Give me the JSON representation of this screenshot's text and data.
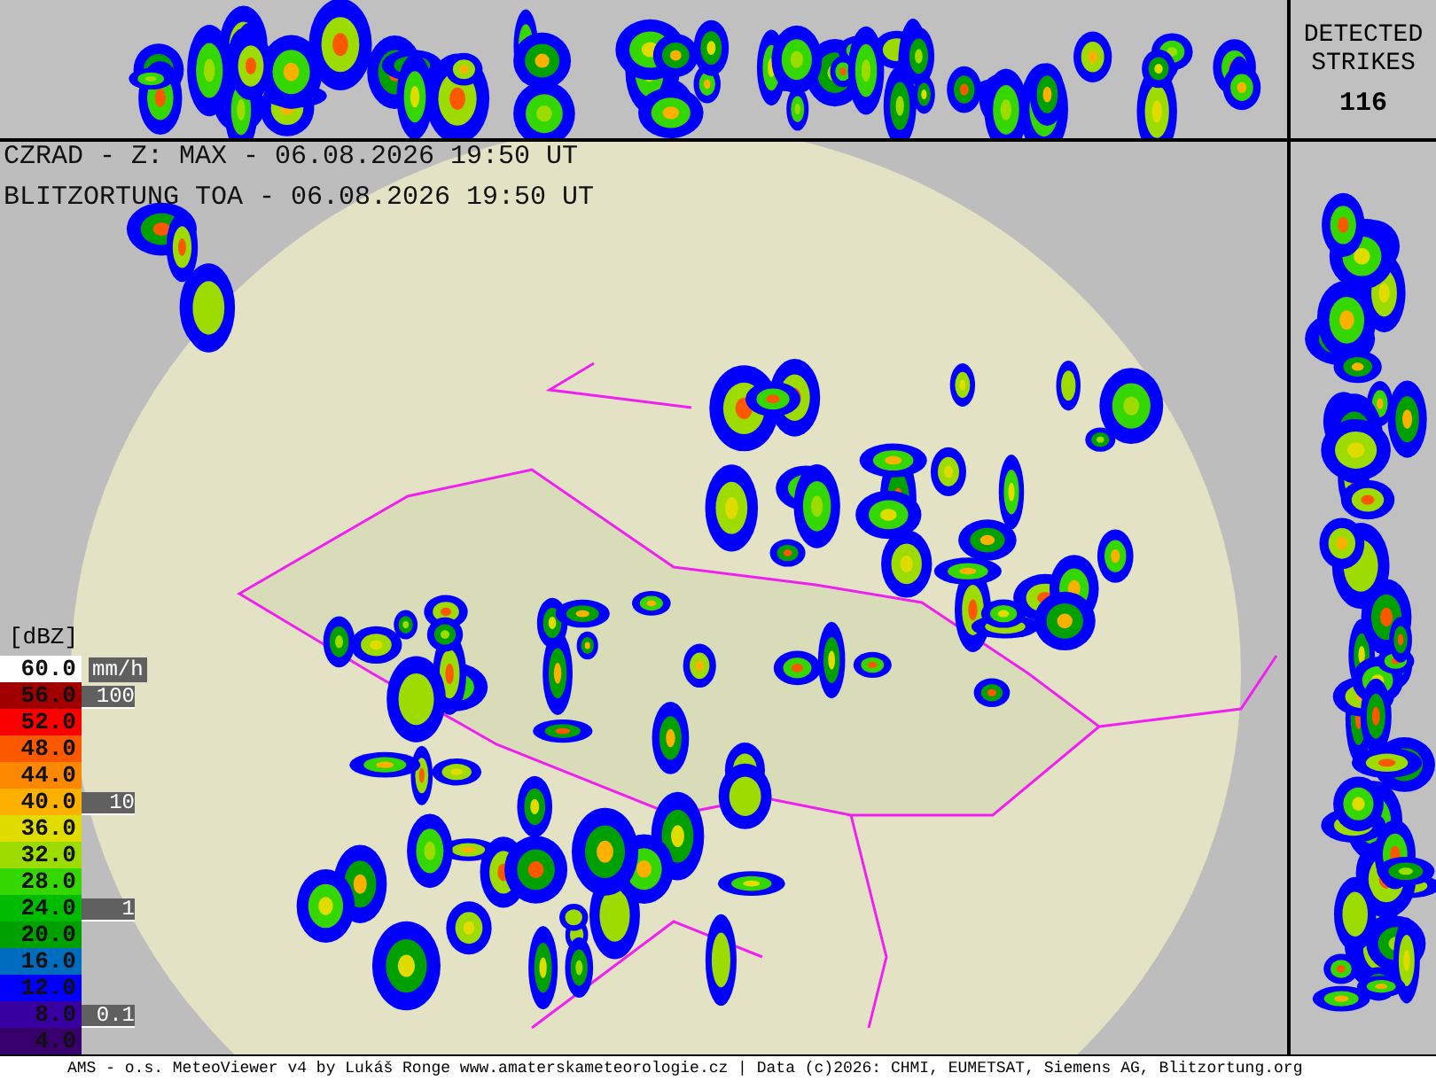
{
  "overlay": {
    "lines": [
      "CZRAD - Z: MAX - 06.08.2026 19:50 UT",
      "BLITZORTUNG TOA - 06.08.2026 19:50 UT"
    ]
  },
  "strikes": {
    "label": "DETECTED STRIKES",
    "count": "116"
  },
  "legend": {
    "unit": "[dBZ]",
    "rain_unit": "mm/h",
    "items": [
      {
        "value": "60.0",
        "color": "#ffffff"
      },
      {
        "value": "56.0",
        "color": "#a00000",
        "rain": "100"
      },
      {
        "value": "52.0",
        "color": "#fc0000"
      },
      {
        "value": "48.0",
        "color": "#fc5800"
      },
      {
        "value": "44.0",
        "color": "#fc8800"
      },
      {
        "value": "40.0",
        "color": "#fcb000",
        "rain": "10"
      },
      {
        "value": "36.0",
        "color": "#e0dc00"
      },
      {
        "value": "32.0",
        "color": "#9cdc00"
      },
      {
        "value": "28.0",
        "color": "#34d800"
      },
      {
        "value": "24.0",
        "color": "#00bc00",
        "rain": "1"
      },
      {
        "value": "20.0",
        "color": "#00a000"
      },
      {
        "value": "16.0",
        "color": "#006cc0"
      },
      {
        "value": "12.0",
        "color": "#0000fc"
      },
      {
        "value": "8.0",
        "color": "#3800a0",
        "rain": "0.1"
      },
      {
        "value": "4.0",
        "color": "#38006c"
      }
    ]
  },
  "footer": "AMS - o.s. MeteoViewer v4 by Lukáš Ronge www.amaterskameteorologie.cz | Data (c)2026: CHMI, EUMETSAT, Siemens AG, Blitzortung.org"
}
